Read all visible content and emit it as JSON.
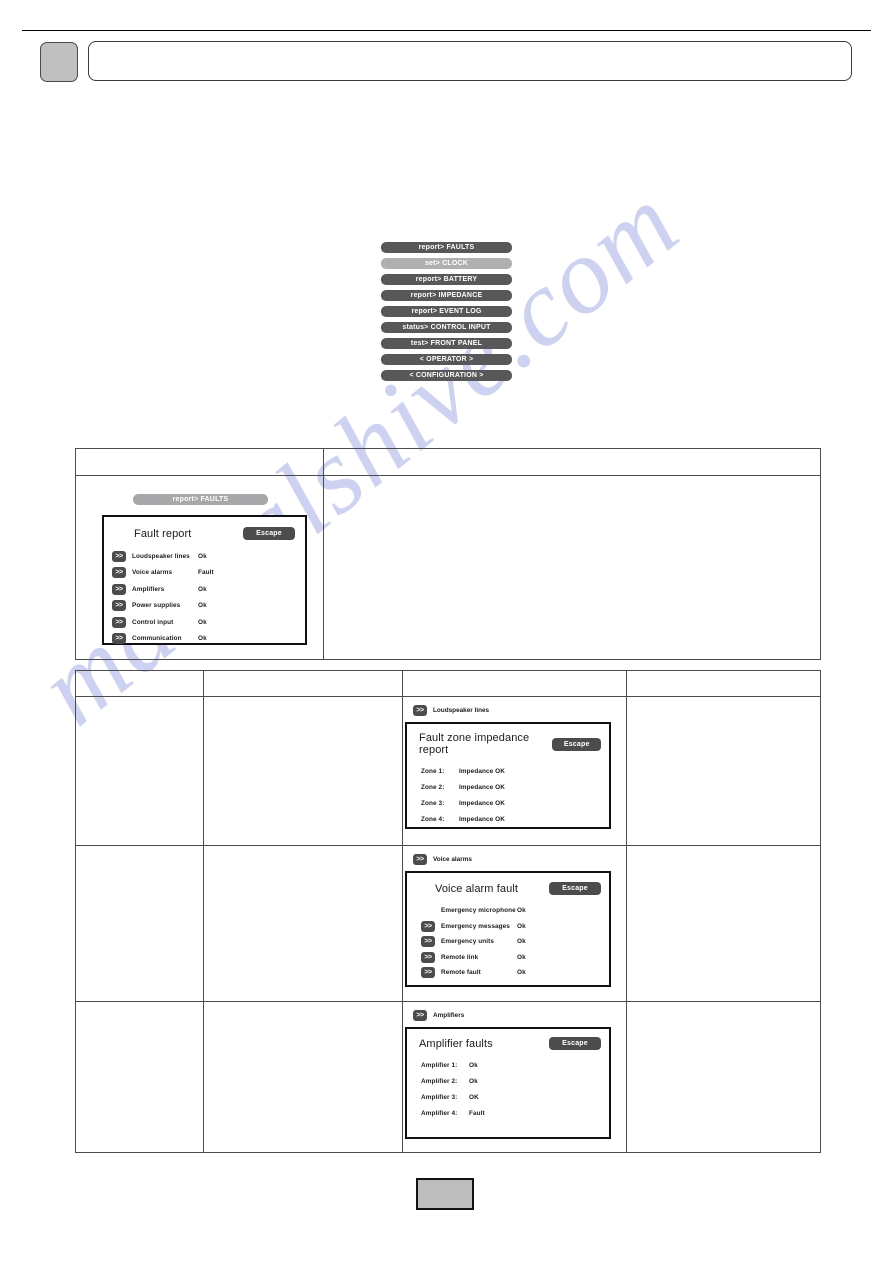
{
  "header": {
    "tab_label": "",
    "title": ""
  },
  "watermark": {
    "text": "manualshive.com"
  },
  "menu": {
    "items": [
      {
        "label": "report>  FAULTS",
        "selected": false
      },
      {
        "label": "set>  CLOCK",
        "selected": true
      },
      {
        "label": "report>  BATTERY",
        "selected": false
      },
      {
        "label": "report>  IMPEDANCE",
        "selected": false
      },
      {
        "label": "report>  EVENT LOG",
        "selected": false
      },
      {
        "label": "status>  CONTROL INPUT",
        "selected": false
      },
      {
        "label": "test>  FRONT PANEL",
        "selected": false
      },
      {
        "label": "< OPERATOR >",
        "selected": false
      },
      {
        "label": "< CONFIGURATION >",
        "selected": false
      }
    ]
  },
  "fault_report": {
    "tag": "report> FAULTS",
    "title": "Fault report",
    "escape_label": "Escape",
    "chevron_glyph": ">>",
    "rows": [
      {
        "chevron": true,
        "label": "Loudspeaker lines",
        "value": "Ok"
      },
      {
        "chevron": true,
        "label": "Voice alarms",
        "value": "Fault"
      },
      {
        "chevron": true,
        "label": "Amplifiers",
        "value": "Ok"
      },
      {
        "chevron": true,
        "label": "Power supplies",
        "value": "Ok"
      },
      {
        "chevron": true,
        "label": "Control input",
        "value": "Ok"
      },
      {
        "chevron": true,
        "label": "Communication",
        "value": "Ok"
      }
    ]
  },
  "impedance_report": {
    "caption": "Loudspeaker lines",
    "caption_chevron": ">>",
    "title": "Fault zone impedance report",
    "escape_label": "Escape",
    "rows": [
      {
        "label": "Zone 1:",
        "value": "Impedance OK"
      },
      {
        "label": "Zone 2:",
        "value": "Impedance OK"
      },
      {
        "label": "Zone 3:",
        "value": "Impedance OK"
      },
      {
        "label": "Zone 4:",
        "value": "Impedance OK"
      }
    ]
  },
  "voice_alarm_report": {
    "caption": "Voice alarms",
    "caption_chevron": ">>",
    "title": "Voice alarm fault",
    "escape_label": "Escape",
    "chevron_glyph": ">>",
    "rows": [
      {
        "chevron": false,
        "label": "Emergency microphone",
        "value": "Ok"
      },
      {
        "chevron": true,
        "label": "Emergency messages",
        "value": "Ok"
      },
      {
        "chevron": true,
        "label": "Emergency units",
        "value": "Ok"
      },
      {
        "chevron": true,
        "label": "Remote link",
        "value": "Ok"
      },
      {
        "chevron": true,
        "label": "Remote fault",
        "value": "Ok"
      }
    ]
  },
  "amplifier_report": {
    "caption": "Amplifiers",
    "caption_chevron": ">>",
    "title": "Amplifier faults",
    "escape_label": "Escape",
    "rows": [
      {
        "label": "Amplifier 1:",
        "value": "Ok"
      },
      {
        "label": "Amplifier 2:",
        "value": "Ok"
      },
      {
        "label": "Amplifier 3:",
        "value": "OK"
      },
      {
        "label": "Amplifier 4:",
        "value": "Fault"
      }
    ]
  },
  "footer": {
    "page_label": ""
  },
  "colors": {
    "menu_bg": "#58585a",
    "menu_selected_bg": "#b0b0b2",
    "panel_tag_bg": "#a8a8aa",
    "escape_bg": "#4c4c4e",
    "watermark": "#ccd0f2",
    "table_border": "#4c4c4c"
  }
}
